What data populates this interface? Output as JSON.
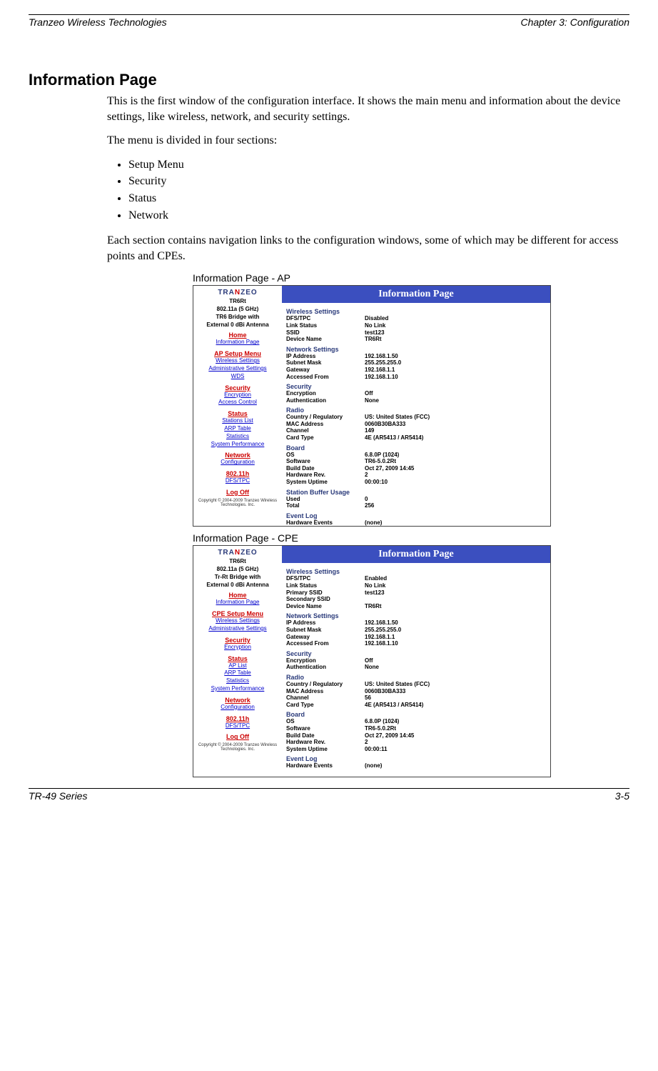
{
  "header": {
    "left": "Tranzeo Wireless Technologies",
    "right": "Chapter 3: Configuration"
  },
  "footer": {
    "left": "TR-49 Series",
    "right": "3-5"
  },
  "title": "Information Page",
  "intro1": "This is the first window of the configuration interface. It shows the main menu and information about the device settings, like wireless, network, and security settings.",
  "intro2": "The menu is divided in four sections:",
  "bullets": [
    "Setup Menu",
    "Security",
    "Status",
    "Network"
  ],
  "intro3": "Each section contains navigation links to the configuration windows, some of which may be different for access points and CPEs.",
  "caption_ap": "Information Page - AP",
  "caption_cpe": "Information Page - CPE",
  "shot_ap": {
    "logo_a": "TRA",
    "logo_b": "N",
    "logo_c": "ZEO",
    "dev1": "TR6Rt",
    "dev2": "802.11a (5 GHz)",
    "dev3": "TR6 Bridge with",
    "dev4": "External 0 dBi Antenna",
    "home": "Home",
    "link_info": "Information Page",
    "setup": "AP Setup Menu",
    "link_ws": "Wireless Settings",
    "link_admin": "Administrative Settings",
    "link_wds": "WDS",
    "security": "Security",
    "link_enc": "Encryption",
    "link_ac": "Access Control",
    "status": "Status",
    "link_sl": "Stations List",
    "link_arp": "ARP Table",
    "link_stat": "Statistics",
    "link_sp": "System Performance",
    "network": "Network",
    "link_conf": "Configuration",
    "g80211h": "802.11h",
    "link_dfs": "DFS/TPC",
    "logoff": "Log Off",
    "copyright": "Copyright © 2004-2009 Tranzeo Wireless Technologies. Inc.",
    "main_title": "Information Page",
    "s_wireless": "Wireless Settings",
    "r_dfs_k": "DFS/TPC",
    "r_dfs_v": "Disabled",
    "r_link_k": "Link Status",
    "r_link_v": "No Link",
    "r_ssid_k": "SSID",
    "r_ssid_v": "test123",
    "r_dn_k": "Device Name",
    "r_dn_v": "TR6Rt",
    "s_network": "Network Settings",
    "r_ip_k": "IP Address",
    "r_ip_v": "192.168.1.50",
    "r_sm_k": "Subnet Mask",
    "r_sm_v": "255.255.255.0",
    "r_gw_k": "Gateway",
    "r_gw_v": "192.168.1.1",
    "r_af_k": "Accessed From",
    "r_af_v": "192.168.1.10",
    "s_security": "Security",
    "r_enc_k": "Encryption",
    "r_enc_v": "Off",
    "r_auth_k": "Authentication",
    "r_auth_v": "None",
    "s_radio": "Radio",
    "r_cr_k": "Country / Regulatory",
    "r_cr_v": "US: United States (FCC)",
    "r_mac_k": "MAC Address",
    "r_mac_v": "0060B30BA333",
    "r_ch_k": "Channel",
    "r_ch_v": "149",
    "r_ct_k": "Card Type",
    "r_ct_v": "4E (AR5413 / AR5414)",
    "s_board": "Board",
    "r_os_k": "OS",
    "r_os_v": "6.8.0P (1024)",
    "r_sw_k": "Software",
    "r_sw_v": "TR6-5.0.2Rt",
    "r_bd_k": "Build Date",
    "r_bd_v": "Oct 27, 2009 14:45",
    "r_hr_k": "Hardware Rev.",
    "r_hr_v": "2",
    "r_su_k": "System Uptime",
    "r_su_v": "00:00:10",
    "s_sbu": "Station Buffer Usage",
    "r_used_k": "Used",
    "r_used_v": "0",
    "r_tot_k": "Total",
    "r_tot_v": "256",
    "s_el": "Event Log",
    "r_he_k": "Hardware Events",
    "r_he_v": "(none)"
  },
  "shot_cpe": {
    "logo_a": "TRA",
    "logo_b": "N",
    "logo_c": "ZEO",
    "dev1": "TR6Rt",
    "dev2": "802.11a (5 GHz)",
    "dev3": "Tr-Rt Bridge with",
    "dev4": "External 0 dBi Antenna",
    "home": "Home",
    "link_info": "Information Page",
    "setup": "CPE Setup Menu",
    "link_ws": "Wireless Settings",
    "link_admin": "Administrative Settings",
    "security": "Security",
    "link_enc": "Encryption",
    "status": "Status",
    "link_apl": "AP List",
    "link_arp": "ARP Table",
    "link_stat": "Statistics",
    "link_sp": "System Performance",
    "network": "Network",
    "link_conf": "Configuration",
    "g80211h": "802.11h",
    "link_dfs": "DFS/TPC",
    "logoff": "Log Off",
    "copyright": "Copyright © 2004-2009 Tranzeo Wireless Technologies. Inc.",
    "main_title": "Information Page",
    "s_wireless": "Wireless Settings",
    "r_dfs_k": "DFS/TPC",
    "r_dfs_v": "Enabled",
    "r_link_k": "Link Status",
    "r_link_v": "No Link",
    "r_pssid_k": "Primary SSID",
    "r_pssid_v": "test123",
    "r_sssid_k": "Secondary SSID",
    "r_sssid_v": "",
    "r_dn_k": "Device Name",
    "r_dn_v": "TR6Rt",
    "s_network": "Network Settings",
    "r_ip_k": "IP Address",
    "r_ip_v": "192.168.1.50",
    "r_sm_k": "Subnet Mask",
    "r_sm_v": "255.255.255.0",
    "r_gw_k": "Gateway",
    "r_gw_v": "192.168.1.1",
    "r_af_k": "Accessed From",
    "r_af_v": "192.168.1.10",
    "s_security": "Security",
    "r_enc_k": "Encryption",
    "r_enc_v": "Off",
    "r_auth_k": "Authentication",
    "r_auth_v": "None",
    "s_radio": "Radio",
    "r_cr_k": "Country / Regulatory",
    "r_cr_v": "US: United States (FCC)",
    "r_mac_k": "MAC Address",
    "r_mac_v": "0060B30BA333",
    "r_ch_k": "Channel",
    "r_ch_v": "56",
    "r_ct_k": "Card Type",
    "r_ct_v": "4E (AR5413 / AR5414)",
    "s_board": "Board",
    "r_os_k": "OS",
    "r_os_v": "6.8.0P (1024)",
    "r_sw_k": "Software",
    "r_sw_v": "TR6-5.0.2Rt",
    "r_bd_k": "Build Date",
    "r_bd_v": "Oct 27, 2009 14:45",
    "r_hr_k": "Hardware Rev.",
    "r_hr_v": "2",
    "r_su_k": "System Uptime",
    "r_su_v": "00:00:11",
    "s_el": "Event Log",
    "r_he_k": "Hardware Events",
    "r_he_v": "(none)"
  }
}
